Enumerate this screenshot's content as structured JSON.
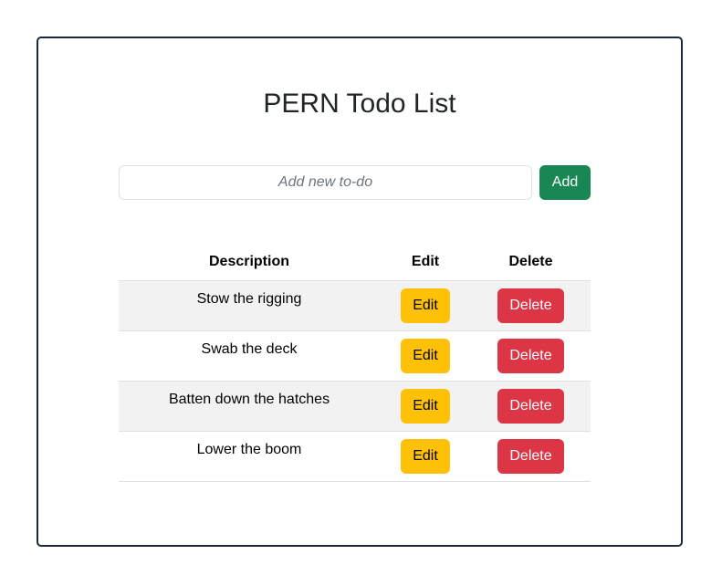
{
  "app": {
    "title": "PERN Todo List"
  },
  "form": {
    "input_value": "",
    "placeholder": "Add new to-do",
    "add_label": "Add"
  },
  "table": {
    "headers": {
      "description": "Description",
      "edit": "Edit",
      "delete": "Delete"
    },
    "rows": [
      {
        "description": "Stow the rigging",
        "edit_label": "Edit",
        "delete_label": "Delete"
      },
      {
        "description": "Swab the deck",
        "edit_label": "Edit",
        "delete_label": "Delete"
      },
      {
        "description": "Batten down the hatches",
        "edit_label": "Edit",
        "delete_label": "Delete"
      },
      {
        "description": "Lower the boom",
        "edit_label": "Edit",
        "delete_label": "Delete"
      }
    ]
  },
  "colors": {
    "add_button": "#198754",
    "edit_button": "#ffc107",
    "delete_button": "#dc3545",
    "card_border": "#1b2a3c",
    "stripe": "#f2f2f2"
  }
}
